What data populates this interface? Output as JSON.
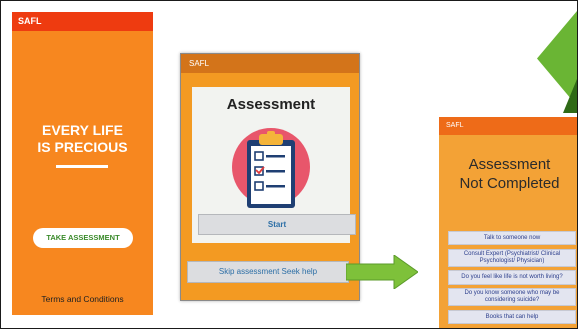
{
  "screen1": {
    "app_name": "SAFL",
    "slogan_line1": "EVERY LIFE",
    "slogan_line2": "IS PRECIOUS",
    "take_assessment": "TAKE ASSESSMENT",
    "terms": "Terms and Conditions"
  },
  "screen2": {
    "app_name": "SAFL",
    "title": "Assessment",
    "start": "Start",
    "skip": "Skip assessment Seek help"
  },
  "screen3": {
    "app_name": "SAFL",
    "title_line1": "Assessment",
    "title_line2": "Not Completed",
    "buttons": [
      "Talk to someone now",
      "Consult Expert (Psychiatrist/ Clinical Psychologist/ Physician)",
      "Do you feel like life is not worth living?",
      "Do you know someone who may be considering suicide?",
      "Books that can help"
    ]
  },
  "colors": {
    "orange": "#f7871f",
    "red_bar": "#ee3b10",
    "green_arrow": "#7ec13a",
    "link_blue": "#2d6fa6"
  },
  "icons": [
    "clipboard-checklist-icon",
    "arrow-right-icon"
  ]
}
